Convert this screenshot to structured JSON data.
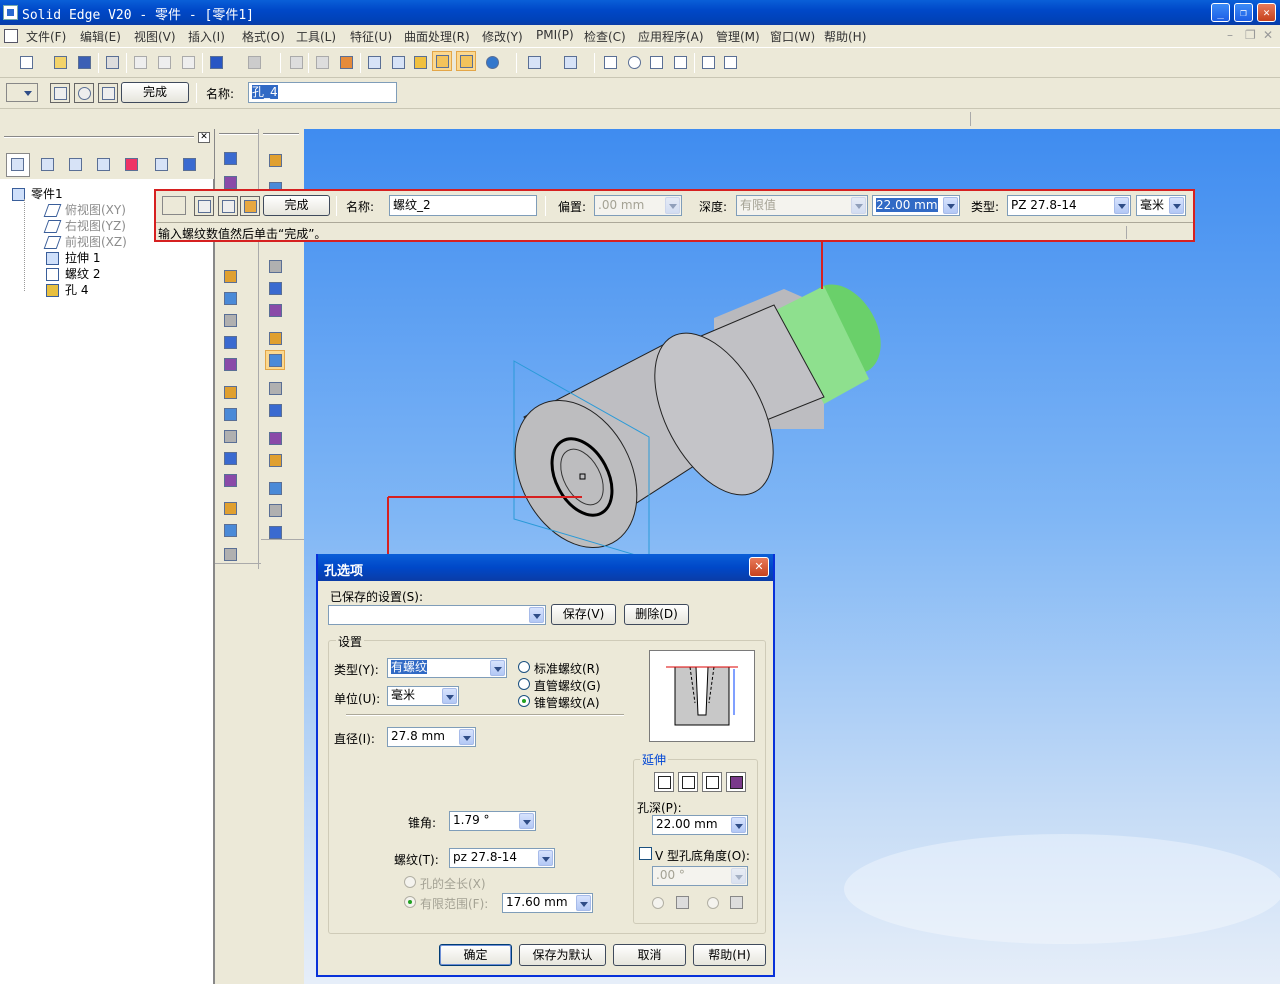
{
  "window": {
    "title": "Solid Edge V20 - 零件 - [零件1]"
  },
  "menu": [
    "文件(F)",
    "编辑(E)",
    "视图(V)",
    "插入(I)",
    "格式(O)",
    "工具(L)",
    "特征(U)",
    "曲面处理(R)",
    "修改(Y)",
    "PMI(P)",
    "检查(C)",
    "应用程序(A)",
    "管理(M)",
    "窗口(W)",
    "帮助(H)"
  ],
  "command_bar": {
    "finish_label": "完成",
    "name_label": "名称:",
    "name_value": "孔_4"
  },
  "tree": {
    "root": "零件1",
    "items": [
      "俯视图(XY)",
      "右视图(YZ)",
      "前视图(XZ)",
      "拉伸 1",
      "螺纹 2",
      "孔 4"
    ]
  },
  "ribbon": {
    "finish_label": "完成",
    "name_label": "名称:",
    "name_value": "螺纹_2",
    "offset_label": "偏置:",
    "offset_value": ".00 mm",
    "depth_label": "深度:",
    "depth_type": "有限值",
    "depth_value": "22.00 mm",
    "type_label": "类型:",
    "type_value": "PZ 27.8-14",
    "unit_value": "毫米",
    "prompt": "输入螺纹数值然后单击“完成”。"
  },
  "dialog": {
    "title": "孔选项",
    "saved_settings_label": "已保存的设置(S):",
    "saved_settings_value": "",
    "save_button": "保存(V)",
    "delete_button": "删除(D)",
    "settings_group": "设置",
    "type_label": "类型(Y):",
    "type_value": "有螺纹",
    "unit_label": "单位(U):",
    "unit_value": "毫米",
    "radio_standard": "标准螺纹(R)",
    "radio_straight_pipe": "直管螺纹(G)",
    "radio_tapered_pipe": "锥管螺纹(A)",
    "diameter_label": "直径(I):",
    "diameter_value": "27.8 mm",
    "taper_label": "锥角:",
    "taper_value": "1.79 °",
    "thread_label": "螺纹(T):",
    "thread_value": "pz 27.8-14",
    "full_length_label": "孔的全长(X)",
    "finite_extent_label": "有限范围(F):",
    "finite_extent_value": "17.60 mm",
    "extent_group": "延伸",
    "hole_depth_label": "孔深(P):",
    "hole_depth_value": "22.00 mm",
    "v_angle_label": "V 型孔底角度(O):",
    "v_angle_value": ".00 °",
    "ok_button": "确定",
    "save_default_button": "保存为默认",
    "cancel_button": "取消",
    "help_button": "帮助(H)"
  },
  "colors": {
    "accent": "#0a5fd8",
    "highlight": "#d62020",
    "thread_green": "#8ee08e"
  }
}
